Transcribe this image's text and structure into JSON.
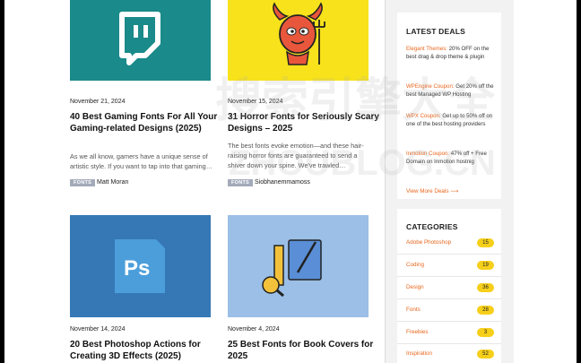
{
  "posts": [
    {
      "date": "November 21, 2024",
      "title": "40 Best Gaming Fonts For All Your Gaming-related Designs (2025)",
      "excerpt": "As we all know, gamers have a unique sense of artistic style. If you want to tap into that gaming…",
      "tag": "FONTS",
      "author": "Matt Moran",
      "thumb_icon": "twitch-icon",
      "thumb_color": "#1a8a8a"
    },
    {
      "date": "November 15, 2024",
      "title": "31 Horror Fonts for Seriously Scary Designs – 2025",
      "excerpt": "The best fonts evoke emotion—and these hair-raising horror fonts are guaranteed to send a shiver down your spine. We've trawled…",
      "tag": "FONTS",
      "author": "Siobhanemmamoss",
      "thumb_icon": "devil-icon",
      "thumb_color": "#f7e21b"
    },
    {
      "date": "November 14, 2024",
      "title": "20 Best Photoshop Actions for Creating 3D Effects (2025)",
      "thumb_icon": "photoshop-icon",
      "thumb_color": "#3578b5"
    },
    {
      "date": "November 4, 2024",
      "title": "25 Best Fonts for Book Covers for 2025",
      "thumb_icon": "design-tools-icon",
      "thumb_color": "#9bbfe6"
    }
  ],
  "sidebar": {
    "deals_title": "LATEST DEALS",
    "deals": [
      {
        "name": "Elegant Themes:",
        "text": " 20% OFF on the best drag & drop theme & plugin"
      },
      {
        "name": "WPEngine Coupon:",
        "text": " Get 20% off the best Managed WP Hosting"
      },
      {
        "name": "WPX Coupon:",
        "text": " Get up to 50% off on one of the best hosting providers"
      },
      {
        "name": "Inmotion Coupon:",
        "text": " 47% off + Free Domain on Inmotion hostnig"
      }
    ],
    "view_more": "View More Deals",
    "categories_title": "CATEGORIES",
    "categories": [
      {
        "label": "Adobe Photoshop",
        "count": "15"
      },
      {
        "label": "Coding",
        "count": "19"
      },
      {
        "label": "Design",
        "count": "36"
      },
      {
        "label": "Fonts",
        "count": "28"
      },
      {
        "label": "Freebies",
        "count": "3"
      },
      {
        "label": "Inspiration",
        "count": "52"
      }
    ]
  },
  "watermark": {
    "cn": "搜索引擎大全",
    "en": "ZHOUBLOG.CN"
  },
  "colors": {
    "accent": "#e8661c",
    "badge": "#f6cf1a",
    "tag_bg": "#a3aab9"
  }
}
